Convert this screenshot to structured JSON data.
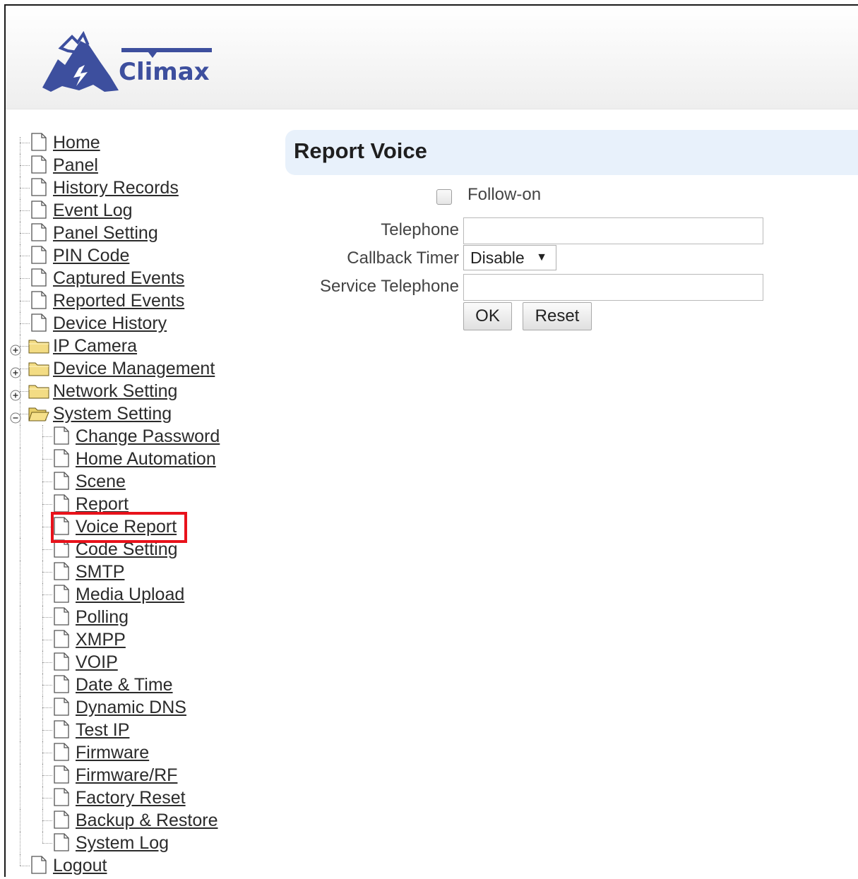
{
  "brand": {
    "name": "Climax",
    "color": "#3d4f9e"
  },
  "accent": {
    "highlight_border": "#e8121b",
    "title_bg": "#e8f1fb"
  },
  "tree": {
    "items": [
      {
        "label": "Home",
        "type": "doc",
        "level": 0
      },
      {
        "label": "Panel",
        "type": "doc",
        "level": 0
      },
      {
        "label": "History Records",
        "type": "doc",
        "level": 0
      },
      {
        "label": "Event Log",
        "type": "doc",
        "level": 0
      },
      {
        "label": "Panel Setting",
        "type": "doc",
        "level": 0
      },
      {
        "label": "PIN Code",
        "type": "doc",
        "level": 0
      },
      {
        "label": "Captured Events",
        "type": "doc",
        "level": 0
      },
      {
        "label": "Reported Events",
        "type": "doc",
        "level": 0
      },
      {
        "label": "Device History",
        "type": "doc",
        "level": 0
      },
      {
        "label": "IP Camera",
        "type": "folder",
        "level": 0,
        "expanded": false
      },
      {
        "label": "Device Management",
        "type": "folder",
        "level": 0,
        "expanded": false
      },
      {
        "label": "Network Setting",
        "type": "folder",
        "level": 0,
        "expanded": false
      },
      {
        "label": "System Setting",
        "type": "folder",
        "level": 0,
        "expanded": true
      },
      {
        "label": "Change Password",
        "type": "doc",
        "level": 1
      },
      {
        "label": "Home Automation",
        "type": "doc",
        "level": 1
      },
      {
        "label": "Scene",
        "type": "doc",
        "level": 1
      },
      {
        "label": "Report",
        "type": "doc",
        "level": 1
      },
      {
        "label": "Voice Report",
        "type": "doc",
        "level": 1,
        "selected": true
      },
      {
        "label": "Code Setting",
        "type": "doc",
        "level": 1
      },
      {
        "label": "SMTP",
        "type": "doc",
        "level": 1
      },
      {
        "label": "Media Upload",
        "type": "doc",
        "level": 1
      },
      {
        "label": "Polling",
        "type": "doc",
        "level": 1
      },
      {
        "label": "XMPP",
        "type": "doc",
        "level": 1
      },
      {
        "label": "VOIP",
        "type": "doc",
        "level": 1
      },
      {
        "label": "Date & Time",
        "type": "doc",
        "level": 1
      },
      {
        "label": "Dynamic DNS",
        "type": "doc",
        "level": 1
      },
      {
        "label": "Test IP",
        "type": "doc",
        "level": 1
      },
      {
        "label": "Firmware",
        "type": "doc",
        "level": 1
      },
      {
        "label": "Firmware/RF",
        "type": "doc",
        "level": 1
      },
      {
        "label": "Factory Reset",
        "type": "doc",
        "level": 1
      },
      {
        "label": "Backup & Restore",
        "type": "doc",
        "level": 1
      },
      {
        "label": "System Log",
        "type": "doc",
        "level": 1
      },
      {
        "label": "Logout",
        "type": "doc",
        "level": 0
      }
    ]
  },
  "main": {
    "title": "Report Voice",
    "follow_on": {
      "label": "Follow-on",
      "checked": false
    },
    "telephone": {
      "label": "Telephone",
      "value": ""
    },
    "callback_timer": {
      "label": "Callback Timer",
      "selected": "Disable"
    },
    "service_telephone": {
      "label": "Service Telephone",
      "value": ""
    },
    "ok_label": "OK",
    "reset_label": "Reset"
  }
}
